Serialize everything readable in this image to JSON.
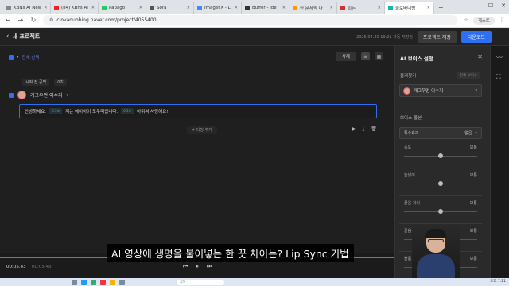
{
  "browser": {
    "tabs": [
      {
        "label": "KBNs AI New"
      },
      {
        "label": "(84) KBns AI"
      },
      {
        "label": "Papago"
      },
      {
        "label": "Sora"
      },
      {
        "label": "ImageFX - L"
      },
      {
        "label": "Buffer - Ide"
      },
      {
        "label": "한 문제씩 나"
      },
      {
        "label": "희든"
      },
      {
        "label": "클로바더빙",
        "active": true
      }
    ],
    "url": "clovadubbing.naver.com/project/4055400",
    "profile": "게스트"
  },
  "app": {
    "project_title": "새 프로젝트",
    "saved_text": "2025.04.20 19:21 자동 저장됨",
    "save_button": "프로젝트 저장",
    "download_button": "다운로드"
  },
  "editor": {
    "select_all": "전체 선택",
    "delete_button": "삭제",
    "silence_label": "시작 전 공백",
    "silence_value": "0초",
    "speaker_name": "개그우먼 이수지",
    "segments": {
      "s1": "안녕하세요.",
      "p1": "0.5초",
      "s2": "저는 에이아이 도우미입니다.",
      "p2": "0.5초",
      "s3": "아뮈써 사랑해요!"
    },
    "add_paragraph": "+ 더빙 추가"
  },
  "panel": {
    "title": "AI 보이스 설정",
    "favorites": "즐겨찾기",
    "all_voices": "전체 보이스",
    "voice_name": "개그우먼 이수지",
    "options_title": "보이스 옵션",
    "effect_label": "특수효과",
    "effect_value": "없음",
    "sliders": [
      {
        "label": "속도",
        "value": "보통",
        "level": 0.5
      },
      {
        "label": "높낮이",
        "value": "보통",
        "level": 0.5
      },
      {
        "label": "끝음 처리",
        "value": "보통",
        "level": 0.5
      },
      {
        "label": "끝음 길이",
        "value": "보통",
        "level": 0.5
      },
      {
        "label": "볼륨 조정",
        "value": "보통",
        "level": 0.5
      }
    ]
  },
  "playback": {
    "current": "00:05.43",
    "total": "00:05.43",
    "progress": 1.0
  },
  "caption": "AI 영상에 생명을 불어넣는 한 끗 차이는? Lip Sync 기법",
  "taskbar": {
    "search_placeholder": "검색",
    "clock": "오후 7:21"
  },
  "colors": {
    "accent": "#2f6ff1",
    "progress": "#e8426a",
    "pause_tag": "#2ebb9a"
  }
}
